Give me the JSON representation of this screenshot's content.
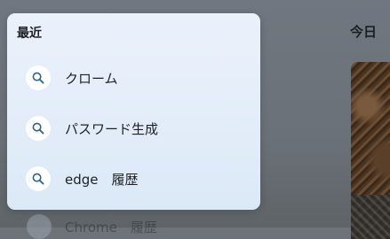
{
  "background": {
    "today_heading": "今日",
    "partial_item": {
      "label": "Chrome　履歴",
      "icon": "search-icon"
    }
  },
  "popup": {
    "title": "最近",
    "items": [
      {
        "label": "クローム",
        "icon": "search-icon"
      },
      {
        "label": "パスワード生成",
        "icon": "search-icon"
      },
      {
        "label": "edge　履歴",
        "icon": "search-icon"
      }
    ]
  },
  "colors": {
    "search_icon": "#2e5f86",
    "popup_background": "#e6eef9",
    "overlay": "#6d7379"
  }
}
